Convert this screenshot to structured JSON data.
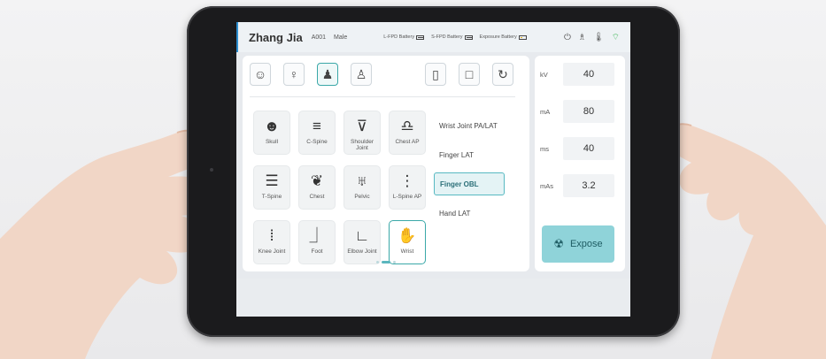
{
  "patient": {
    "name": "Zhang Jia",
    "id": "A001",
    "sex": "Male"
  },
  "batteries": [
    {
      "label": "L-FPD Battery",
      "level": 0.8
    },
    {
      "label": "S-FPD Battery",
      "level": 0.8
    },
    {
      "label": "Exposure Battery",
      "level": 0.3
    }
  ],
  "status_icons": [
    "power-icon",
    "person-icon",
    "thermometer-icon",
    "wifi-icon"
  ],
  "pose_buttons": [
    {
      "icon": "head-pose-icon",
      "glyph": "☺",
      "selected": false
    },
    {
      "icon": "standing-pose-icon",
      "glyph": "♀",
      "selected": false
    },
    {
      "icon": "body-front-pose-icon",
      "glyph": "♟",
      "selected": true
    },
    {
      "icon": "body-side-pose-icon",
      "glyph": "♙",
      "selected": false
    }
  ],
  "detector_buttons": [
    {
      "icon": "large-detector-icon",
      "glyph": "▯"
    },
    {
      "icon": "small-detector-icon",
      "glyph": "□"
    },
    {
      "icon": "rotate-icon",
      "glyph": "↻"
    }
  ],
  "body_parts": [
    {
      "label": "Skull",
      "glyph": "☻",
      "selected": false
    },
    {
      "label": "C-Spine",
      "glyph": "≡",
      "selected": false
    },
    {
      "label": "Shoulder Joint",
      "glyph": "⊽",
      "selected": false
    },
    {
      "label": "Chest AP",
      "glyph": "♎",
      "selected": false
    },
    {
      "label": "T-Spine",
      "glyph": "☰",
      "selected": false
    },
    {
      "label": "Chest",
      "glyph": "❦",
      "selected": false
    },
    {
      "label": "Pelvic",
      "glyph": "♅",
      "selected": false
    },
    {
      "label": "L-Spine AP",
      "glyph": "⋮",
      "selected": false
    },
    {
      "label": "Knee Joint",
      "glyph": "⦙",
      "selected": false
    },
    {
      "label": "Foot",
      "glyph": "⏌",
      "selected": false
    },
    {
      "label": "Elbow Joint",
      "glyph": "∟",
      "selected": false
    },
    {
      "label": "Wrist",
      "glyph": "✋",
      "selected": true
    }
  ],
  "views": [
    {
      "label": "Wrist Joint PA/LAT",
      "selected": false
    },
    {
      "label": "Finger LAT",
      "selected": false
    },
    {
      "label": "Finger OBL",
      "selected": true
    },
    {
      "label": "Hand LAT",
      "selected": false
    }
  ],
  "pager": {
    "pages": 3,
    "active": 2
  },
  "params": [
    {
      "label": "kV",
      "value": "40"
    },
    {
      "label": "mA",
      "value": "80"
    },
    {
      "label": "ms",
      "value": "40"
    },
    {
      "label": "mAs",
      "value": "3.2"
    }
  ],
  "expose": {
    "label": "Expose",
    "icon": "radiation-icon"
  },
  "colors": {
    "accent": "#3aa8a8",
    "expose_bg": "#8fd3d9",
    "wifi": "#2fb14a"
  }
}
